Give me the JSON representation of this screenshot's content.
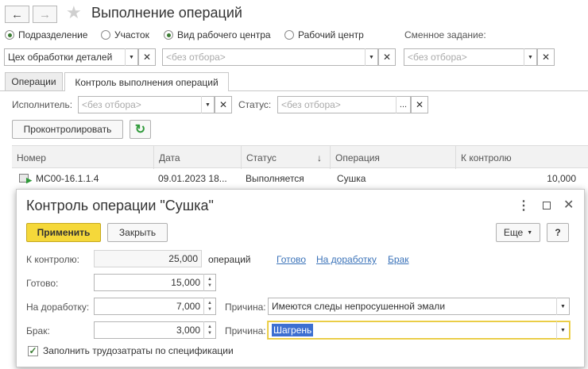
{
  "window": {
    "title": "Выполнение операций"
  },
  "radio_row": {
    "options": [
      {
        "label": "Подразделение",
        "selected": true
      },
      {
        "label": "Участок",
        "selected": false
      },
      {
        "label": "Вид рабочего центра",
        "selected": true
      },
      {
        "label": "Рабочий центр",
        "selected": false
      }
    ],
    "shift_task_label": "Сменное задание:"
  },
  "filters": {
    "department_value": "Цех обработки деталей",
    "workcenter_placeholder": "<без отбора>",
    "shift_task_placeholder": "<без отбора>"
  },
  "tabs": [
    {
      "label": "Операции",
      "active": false
    },
    {
      "label": "Контроль выполнения операций",
      "active": true
    }
  ],
  "control_filters": {
    "performer_label": "Исполнитель:",
    "performer_placeholder": "<без отбора>",
    "status_label": "Статус:",
    "status_placeholder": "<без отбора>",
    "ellipsis": "..."
  },
  "toolbar": {
    "control_button": "Проконтролировать"
  },
  "table": {
    "columns": [
      "Номер",
      "Дата",
      "Статус",
      "Операция",
      "К контролю"
    ],
    "sort_arrow": "↓",
    "rows": [
      {
        "number": "МС00-16.1.1.4",
        "date": "09.01.2023 18...",
        "status": "Выполняется",
        "operation": "Сушка",
        "to_control": "10,000"
      }
    ]
  },
  "dialog": {
    "title": "Контроль операции \"Сушка\"",
    "apply_button": "Применить",
    "close_button": "Закрыть",
    "more_button": "Еще",
    "help_button": "?",
    "to_control_label": "К контролю:",
    "to_control_value": "25,000",
    "operations_unit": "операций",
    "links": [
      "Готово",
      "На доработку",
      "Брак"
    ],
    "ready_label": "Готово:",
    "ready_value": "15,000",
    "rework_label": "На доработку:",
    "rework_value": "7,000",
    "reason_label": "Причина:",
    "rework_reason": "Имеются следы непросушенной эмали",
    "defect_label": "Брак:",
    "defect_value": "3,000",
    "defect_reason": "Шагрень",
    "fill_labor_label": "Заполнить трудозатраты по спецификации",
    "fill_labor_checked": true
  },
  "colors": {
    "accent_yellow": "#f5d83a",
    "link_blue": "#3b73b9",
    "green": "#3b7d33",
    "selection": "#3d6fd1"
  }
}
